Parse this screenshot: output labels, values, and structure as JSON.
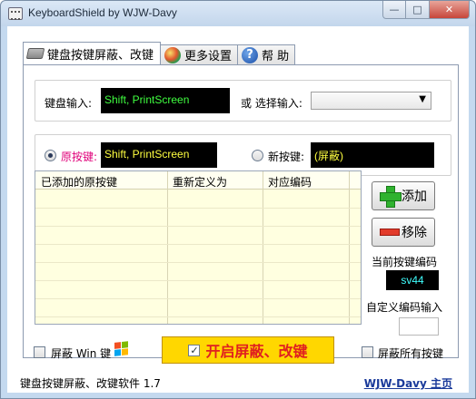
{
  "window": {
    "title": "KeyboardShield by WJW-Davy",
    "minimize": "—",
    "maximize": "□",
    "close": "✕"
  },
  "tabs": [
    {
      "label": "键盘按键屏蔽、改键",
      "icon": "keyboard-icon",
      "active": true
    },
    {
      "label": "更多设置",
      "icon": "globe-icon",
      "active": false
    },
    {
      "label": "帮 助",
      "icon": "help-icon",
      "active": false
    }
  ],
  "keyboard_input": {
    "label": "键盘输入:",
    "value": "Shift, PrintScreen",
    "or_select_label": "或 选择输入:",
    "select_value": ""
  },
  "mapping": {
    "original_label": "原按键:",
    "original_value": "Shift, PrintScreen",
    "original_selected": true,
    "new_label": "新按键:",
    "new_value": "(屏蔽)",
    "new_selected": false
  },
  "list": {
    "columns": [
      "已添加的原按键",
      "重新定义为",
      "对应编码"
    ],
    "rows": []
  },
  "buttons": {
    "add": "添加",
    "remove": "移除",
    "start": "开启屏蔽、改键"
  },
  "code": {
    "current_label": "当前按键编码",
    "current_value": "sv44",
    "custom_label": "自定义编码输入",
    "custom_value": ""
  },
  "options": {
    "block_win_label": "屏蔽 Win 键",
    "block_win_checked": false,
    "block_all_label": "屏蔽所有按键",
    "block_all_checked": false,
    "start_checked": true
  },
  "status": {
    "version": "键盘按键屏蔽、改键软件 1.7",
    "link": "WJW-Davy 主页"
  },
  "colors": {
    "input_text": "#40ff40",
    "mapping_text": "#ffff40",
    "code_text": "#40ffff",
    "original_label": "#e0007a",
    "start_button_bg": "#ffd700",
    "start_button_text": "#e02020",
    "list_bg": "#ffffe0"
  }
}
